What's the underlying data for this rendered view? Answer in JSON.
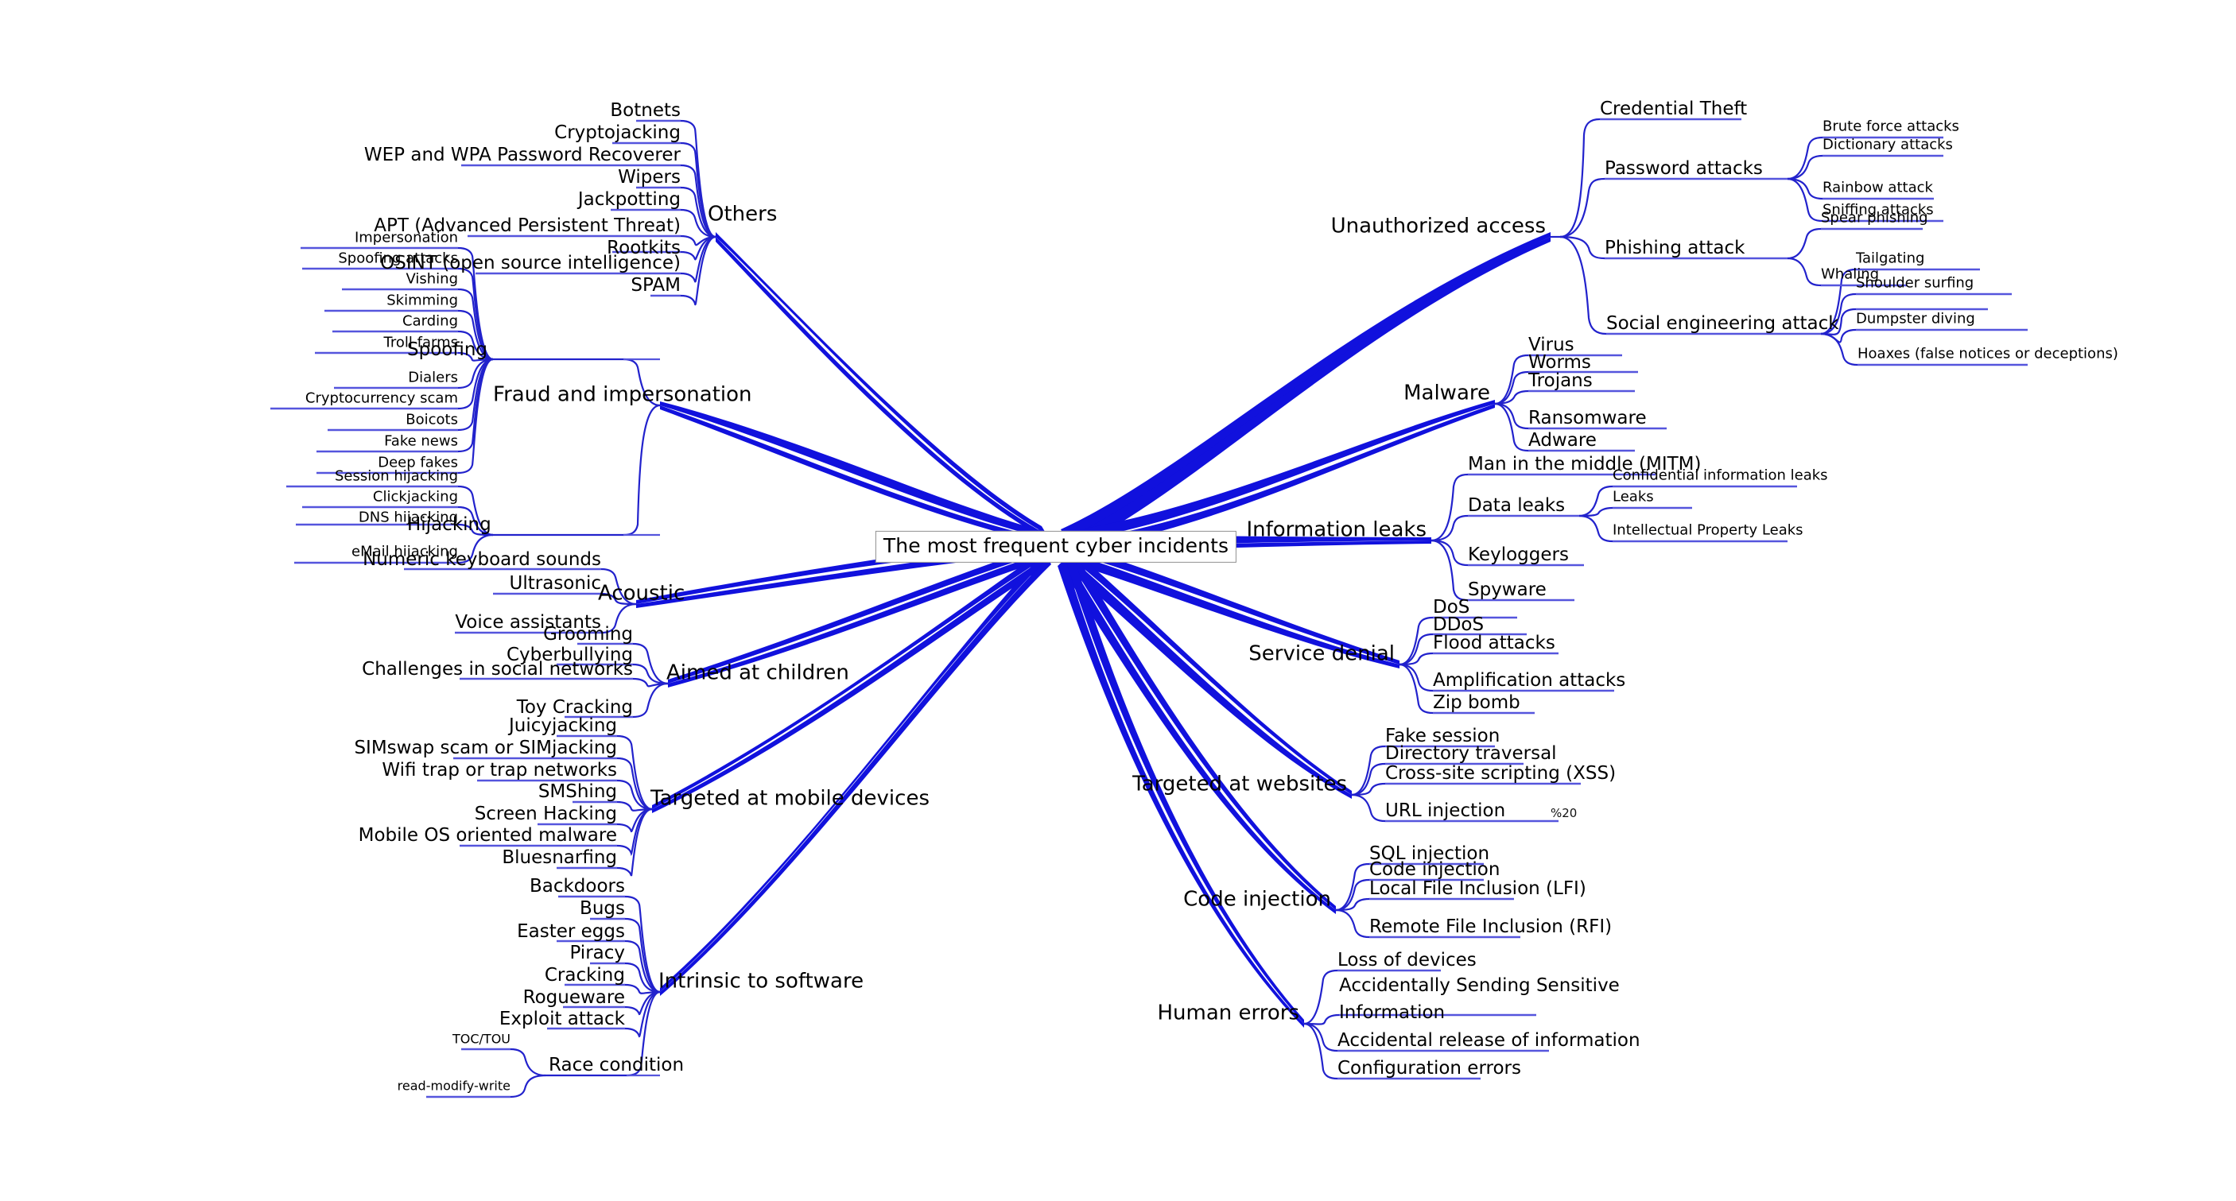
{
  "colors": {
    "branch_blue": "#1111dd",
    "sub_branch_blue": "#3333cc",
    "leaf_blue": "#5555dd",
    "text": "#000000",
    "root_border": "#909090",
    "background": "#ffffff"
  },
  "root": {
    "label": "The most frequent cyber incidents"
  },
  "chart_data": {
    "type": "diagram",
    "diagram_type": "mind-map",
    "title": "The most frequent cyber incidents",
    "root": "The most frequent cyber incidents",
    "branch_count": 13,
    "layout": "radial, 5 branches right / 8 branches left"
  },
  "branches": {
    "right": [
      {
        "label": "Unauthorized access",
        "children": [
          {
            "label": "Credential Theft",
            "children": []
          },
          {
            "label": "Password attacks",
            "children": [
              {
                "label": "Brute force attacks"
              },
              {
                "label": "Dictionary attacks"
              },
              {
                "label": "Rainbow attack"
              },
              {
                "label": "Sniffing attacks"
              }
            ]
          },
          {
            "label": "Phishing attack",
            "children": [
              {
                "label": "Spear phishing"
              },
              {
                "label": "Whaling"
              }
            ]
          },
          {
            "label": "Social engineering attack",
            "children": [
              {
                "label": "Tailgating"
              },
              {
                "label": "Shoulder surfing"
              },
              {
                "label": "Dumpster diving"
              },
              {
                "label": "Hoaxes (false notices or deceptions)"
              }
            ]
          }
        ]
      },
      {
        "label": "Malware",
        "children": [
          {
            "label": "Virus",
            "children": []
          },
          {
            "label": "Worms",
            "children": []
          },
          {
            "label": "Trojans",
            "children": []
          },
          {
            "label": "Ransomware",
            "children": []
          },
          {
            "label": "Adware",
            "children": []
          }
        ]
      },
      {
        "label": "Information leaks",
        "children": [
          {
            "label": "Man in the middle (MITM)",
            "children": []
          },
          {
            "label": "Data leaks",
            "children": [
              {
                "label": "Confidential information leaks"
              },
              {
                "label": "Leaks"
              },
              {
                "label": "Intellectual Property Leaks"
              }
            ]
          },
          {
            "label": "Keyloggers",
            "children": []
          },
          {
            "label": "Spyware",
            "children": []
          }
        ]
      },
      {
        "label": "Service denial",
        "children": [
          {
            "label": "DoS",
            "children": []
          },
          {
            "label": "DDoS",
            "children": []
          },
          {
            "label": "Flood attacks",
            "children": []
          },
          {
            "label": "Amplification attacks",
            "children": []
          },
          {
            "label": "Zip bomb",
            "children": []
          }
        ]
      },
      {
        "label": "Targeted at websites",
        "children": [
          {
            "label": "Fake session",
            "children": []
          },
          {
            "label": "Directory traversal",
            "children": []
          },
          {
            "label": "Cross-site scripting (XSS)",
            "children": []
          },
          {
            "label": "URL injection",
            "note": "%20",
            "children": []
          }
        ]
      },
      {
        "label": "Code injection",
        "children": [
          {
            "label": "SQL injection",
            "children": []
          },
          {
            "label": "Code injection",
            "children": []
          },
          {
            "label": "Local File Inclusion (LFI)",
            "children": []
          },
          {
            "label": "Remote File Inclusion (RFI)",
            "children": []
          }
        ]
      },
      {
        "label": "Human errors",
        "children": [
          {
            "label": "Loss of devices",
            "children": []
          },
          {
            "label": "Accidentally Sending Sensitive",
            "children": []
          },
          {
            "label": "Information",
            "children": []
          },
          {
            "label": "Accidental release of information",
            "children": []
          },
          {
            "label": "Configuration errors",
            "children": []
          }
        ]
      }
    ],
    "left": [
      {
        "label": "Others",
        "children": [
          {
            "label": "Botnets"
          },
          {
            "label": "Cryptojacking"
          },
          {
            "label": "WEP and WPA Password Recoverer"
          },
          {
            "label": "Wipers"
          },
          {
            "label": "Jackpotting"
          },
          {
            "label": "APT (Advanced Persistent Threat)"
          },
          {
            "label": "Rootkits"
          },
          {
            "label": "OSINT (open source intelligence)"
          },
          {
            "label": "SPAM"
          }
        ]
      },
      {
        "label": "Fraud and impersonation",
        "children": [
          {
            "label": "Spoofing",
            "children": [
              {
                "label": "Impersonation"
              },
              {
                "label": "Spoofing attacks"
              },
              {
                "label": "Vishing"
              },
              {
                "label": "Skimming"
              },
              {
                "label": "Carding"
              },
              {
                "label": "Troll farms"
              },
              {
                "label": "Dialers"
              },
              {
                "label": "Cryptocurrency scam"
              },
              {
                "label": "Boicots"
              },
              {
                "label": "Fake news"
              },
              {
                "label": "Deep fakes"
              }
            ]
          },
          {
            "label": "Hijacking",
            "children": [
              {
                "label": "Session hijacking"
              },
              {
                "label": "Clickjacking"
              },
              {
                "label": "DNS hijacking"
              },
              {
                "label": "eMail hijacking"
              }
            ]
          }
        ]
      },
      {
        "label": "Acoustic",
        "children": [
          {
            "label": "Numeric keyboard sounds"
          },
          {
            "label": "Ultrasonic"
          },
          {
            "label": "Voice assistants"
          }
        ]
      },
      {
        "label": "Aimed at children",
        "children": [
          {
            "label": "Grooming"
          },
          {
            "label": "Cyberbullying"
          },
          {
            "label": "Challenges in social networks"
          },
          {
            "label": "Toy Cracking"
          }
        ]
      },
      {
        "label": "Targeted at mobile devices",
        "children": [
          {
            "label": "Juicyjacking"
          },
          {
            "label": "SIMswap scam or SIMjacking"
          },
          {
            "label": "Wifi trap or trap networks"
          },
          {
            "label": "SMShing"
          },
          {
            "label": "Screen Hacking"
          },
          {
            "label": "Mobile OS oriented malware"
          },
          {
            "label": "Bluesnarfing"
          }
        ]
      },
      {
        "label": "Intrinsic to software",
        "children": [
          {
            "label": "Backdoors"
          },
          {
            "label": "Bugs"
          },
          {
            "label": "Easter eggs"
          },
          {
            "label": "Piracy"
          },
          {
            "label": "Cracking"
          },
          {
            "label": "Rogueware"
          },
          {
            "label": "Exploit attack"
          },
          {
            "label": "Race condition",
            "children": [
              {
                "label": "TOC/TOU"
              },
              {
                "label": "read-modify-write"
              }
            ]
          }
        ]
      }
    ]
  },
  "labels": {
    "root": "The most frequent cyber incidents",
    "r_unauthorized": "Unauthorized access",
    "r_credential_theft": "Credential Theft",
    "r_password_attacks": "Password attacks",
    "r_brute_force": "Brute force attacks",
    "r_dictionary": "Dictionary attacks",
    "r_rainbow": "Rainbow attack",
    "r_sniffing": "Sniffing attacks",
    "r_phishing": "Phishing attack",
    "r_spear": "Spear phishing",
    "r_whaling": "Whaling",
    "r_social_eng": "Social engineering attack",
    "r_tailgating": "Tailgating",
    "r_shoulder": "Shoulder surfing",
    "r_dumpster": "Dumpster diving",
    "r_hoaxes": "Hoaxes (false notices or deceptions)",
    "r_malware": "Malware",
    "r_virus": "Virus",
    "r_worms": "Worms",
    "r_trojans": "Trojans",
    "r_ransomware": "Ransomware",
    "r_adware": "Adware",
    "r_infoleaks": "Information leaks",
    "r_mitm": "Man in the middle (MITM)",
    "r_dataleaks": "Data leaks",
    "r_confidential": "Confidential information leaks",
    "r_leaks": "Leaks",
    "r_ip_leaks": "Intellectual Property Leaks",
    "r_keyloggers": "Keyloggers",
    "r_spyware": "Spyware",
    "r_service_denial": "Service denial",
    "r_dos": "DoS",
    "r_ddos": "DDoS",
    "r_flood": "Flood attacks",
    "r_amplification": "Amplification attacks",
    "r_zipbomb": "Zip bomb",
    "r_websites": "Targeted at websites",
    "r_fake_session": "Fake session",
    "r_dir_traversal": "Directory traversal",
    "r_xss": "Cross-site scripting (XSS)",
    "r_url_injection": "URL injection",
    "r_url_note": "%20",
    "r_code_injection": "Code injection",
    "r_sql": "SQL injection",
    "r_code_inj2": "Code injection",
    "r_lfi": "Local File Inclusion (LFI)",
    "r_rfi": "Remote File Inclusion (RFI)",
    "r_human_errors": "Human errors",
    "r_loss_devices": "Loss of devices",
    "r_accidental_send": "Accidentally Sending Sensitive",
    "r_information": "Information",
    "r_accidental_release": "Accidental release of information",
    "r_config_errors": "Configuration errors",
    "l_others": "Others",
    "l_botnets": "Botnets",
    "l_cryptojacking": "Cryptojacking",
    "l_wep_wpa": "WEP and WPA Password Recoverer",
    "l_wipers": "Wipers",
    "l_jackpotting": "Jackpotting",
    "l_apt": "APT (Advanced Persistent Threat)",
    "l_rootkits": "Rootkits",
    "l_osint": "OSINT (open source intelligence)",
    "l_spam": "SPAM",
    "l_fraud": "Fraud and impersonation",
    "l_spoofing": "Spoofing",
    "l_impersonation": "Impersonation",
    "l_spoofing_attacks": "Spoofing attacks",
    "l_vishing": "Vishing",
    "l_skimming": "Skimming",
    "l_carding": "Carding",
    "l_troll_farms": "Troll farms",
    "l_dialers": "Dialers",
    "l_crypto_scam": "Cryptocurrency scam",
    "l_boicots": "Boicots",
    "l_fake_news": "Fake news",
    "l_deep_fakes": "Deep fakes",
    "l_hijacking": "Hijacking",
    "l_session_hijacking": "Session hijacking",
    "l_clickjacking": "Clickjacking",
    "l_dns_hijacking": "DNS hijacking",
    "l_email_hijacking": "eMail hijacking",
    "l_acoustic": "Acoustic",
    "l_numeric_kb": "Numeric keyboard sounds",
    "l_ultrasonic": "Ultrasonic",
    "l_voice_assistants": "Voice assistants",
    "l_children": "Aimed at children",
    "l_grooming": "Grooming",
    "l_cyberbullying": "Cyberbullying",
    "l_challenges": "Challenges in social networks",
    "l_toy_cracking": "Toy Cracking",
    "l_mobile": "Targeted at mobile devices",
    "l_juicyjacking": "Juicyjacking",
    "l_simswap": "SIMswap scam or SIMjacking",
    "l_wifi_trap": "Wifi trap or trap networks",
    "l_smshing": "SMShing",
    "l_screen_hacking": "Screen Hacking",
    "l_mobile_os": "Mobile OS oriented malware",
    "l_bluesnarfing": "Bluesnarfing",
    "l_software": "Intrinsic to software",
    "l_backdoors": "Backdoors",
    "l_bugs": "Bugs",
    "l_easter_eggs": "Easter eggs",
    "l_piracy": "Piracy",
    "l_cracking": "Cracking",
    "l_rogueware": "Rogueware",
    "l_exploit": "Exploit attack",
    "l_race_condition": "Race condition",
    "l_toctou": "TOC/TOU",
    "l_rmw": "read-modify-write"
  }
}
